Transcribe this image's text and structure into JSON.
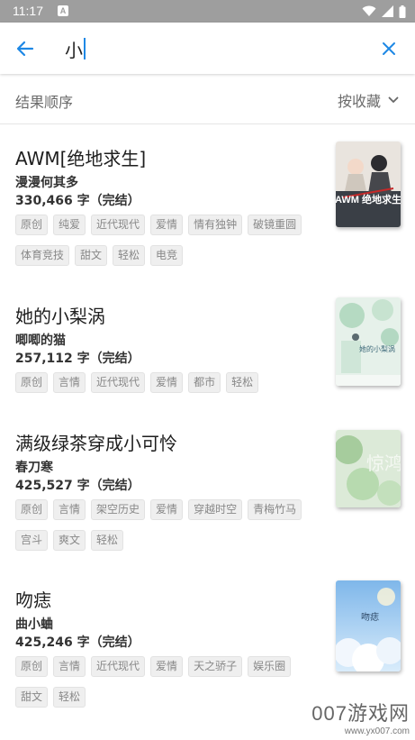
{
  "status_bar": {
    "time": "11:17",
    "notification": "A"
  },
  "search": {
    "query": "小"
  },
  "sort": {
    "label": "结果顺序",
    "selected": "按收藏"
  },
  "books": [
    {
      "title": "AWM[绝地求生]",
      "author": "漫漫何其多",
      "words": "330,466 字（完结）",
      "tags": [
        "原创",
        "纯爱",
        "近代现代",
        "爱情",
        "情有独钟",
        "破镜重圆",
        "体育竞技",
        "甜文",
        "轻松",
        "电竞"
      ],
      "cover_text": "AWM 绝地求生"
    },
    {
      "title": "她的小梨涡",
      "author": "唧唧的猫",
      "words": "257,112 字（完结）",
      "tags": [
        "原创",
        "言情",
        "近代现代",
        "爱情",
        "都市",
        "轻松"
      ],
      "cover_text": "她的小梨涡"
    },
    {
      "title": "满级绿茶穿成小可怜",
      "author": "春刀寒",
      "words": "425,527 字（完结）",
      "tags": [
        "原创",
        "言情",
        "架空历史",
        "爱情",
        "穿越时空",
        "青梅竹马",
        "宫斗",
        "爽文",
        "轻松"
      ],
      "cover_text": "惊鸿"
    },
    {
      "title": "吻痣",
      "author": "曲小蛐",
      "words": "425,246 字（完结）",
      "tags": [
        "原创",
        "言情",
        "近代现代",
        "爱情",
        "天之骄子",
        "娱乐圈",
        "甜文",
        "轻松"
      ],
      "cover_text": "吻痣"
    }
  ],
  "watermark": {
    "brand": "007游戏网",
    "url": "www.yx007.com"
  }
}
